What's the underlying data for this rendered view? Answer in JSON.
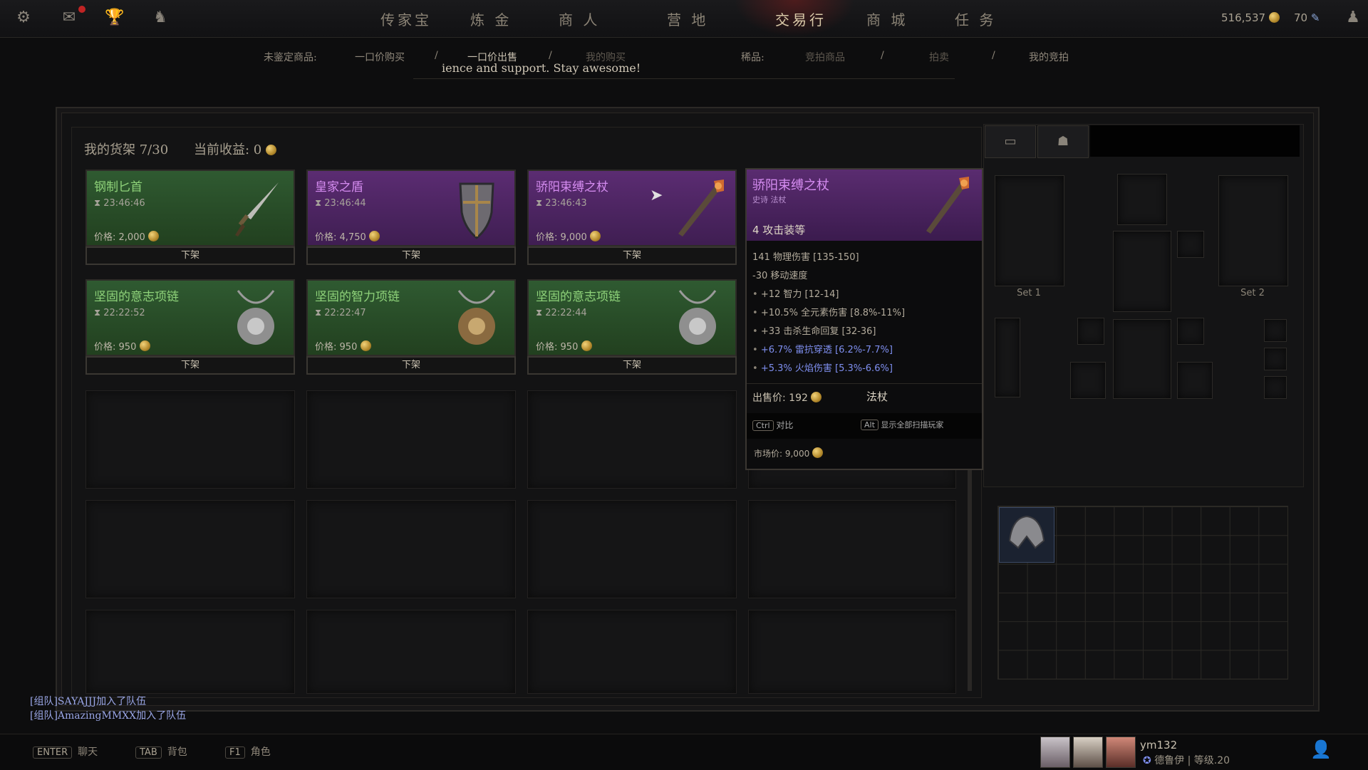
{
  "topbar": {
    "tabs": [
      "传家宝",
      "炼 金",
      "商 人",
      "营 地",
      "交易行",
      "商 城",
      "任 务"
    ],
    "active_tab": "交易行",
    "gold": "516,537",
    "shards": "70"
  },
  "subnav": {
    "unidentified_label": "未鉴定商品:",
    "items": [
      "一口价购买",
      "/",
      "一口价出售",
      "/",
      "我的购买",
      "稀品:",
      "竞拍商品",
      "/",
      "拍卖",
      "/",
      "我的竞拍"
    ]
  },
  "notice": "ience and support. Stay awesome!",
  "shelf": {
    "title": "我的货架 7/30",
    "income": "当前收益:  0",
    "price_prefix": "价格:",
    "unlist_label": "下架",
    "cards": [
      {
        "name": "钢制匕首",
        "time": "23:46:46",
        "price": "2,000",
        "rarity": "green",
        "icon": "dagger-icon"
      },
      {
        "name": "皇家之盾",
        "time": "23:46:44",
        "price": "4,750",
        "rarity": "purple",
        "icon": "shield-icon"
      },
      {
        "name": "骄阳束缚之杖",
        "time": "23:46:43",
        "price": "9,000",
        "rarity": "purple",
        "icon": "staff-icon"
      },
      {
        "name": "坚固的意志项链",
        "time": "22:22:52",
        "price": "950",
        "rarity": "green",
        "icon": "necklace-icon"
      },
      {
        "name": "坚固的智力项链",
        "time": "22:22:47",
        "price": "950",
        "rarity": "green",
        "icon": "necklace-icon"
      },
      {
        "name": "坚固的意志项链",
        "time": "22:22:44",
        "price": "950",
        "rarity": "green",
        "icon": "necklace-icon"
      }
    ]
  },
  "tooltip": {
    "name": "骄阳束缚之杖",
    "subtitle": "史诗 法杖",
    "tier": "4 攻击装等",
    "lines": [
      {
        "text": "141 物理伤害 [135-150]",
        "style": "plain"
      },
      {
        "text": "-30 移动速度",
        "style": "plain"
      },
      {
        "text": "+12 智力 [12-14]",
        "style": "bullet"
      },
      {
        "text": "+10.5% 全元素伤害 [8.8%-11%]",
        "style": "bullet"
      },
      {
        "text": "+33 击杀生命回复 [32-36]",
        "style": "bullet"
      },
      {
        "text": "+6.7% 雷抗穿透 [6.2%-7.7%]",
        "style": "blue"
      },
      {
        "text": "+5.3% 火焰伤害 [5.3%-6.6%]",
        "style": "blue"
      }
    ],
    "sell_price": "出售价: 192",
    "type": "法杖",
    "ctrl_key": "Ctrl",
    "ctrl_label": "对比",
    "alt_key": "Alt",
    "alt_label": "显示全部扫描玩家",
    "market_price": "市场价:   9,000"
  },
  "equipment": {
    "set1_label": "Set 1",
    "set2_label": "Set 2"
  },
  "chat": [
    "[组队]SAYAJJJ加入了队伍",
    "[组队]AmazingMMXX加入了队伍"
  ],
  "bottombar": {
    "hotkeys": [
      {
        "key": "ENTER",
        "label": "聊天"
      },
      {
        "key": "TAB",
        "label": "背包"
      },
      {
        "key": "F1",
        "label": "角色"
      }
    ],
    "player_name": "ym132",
    "player_class": "德鲁伊 | 等级.20"
  }
}
